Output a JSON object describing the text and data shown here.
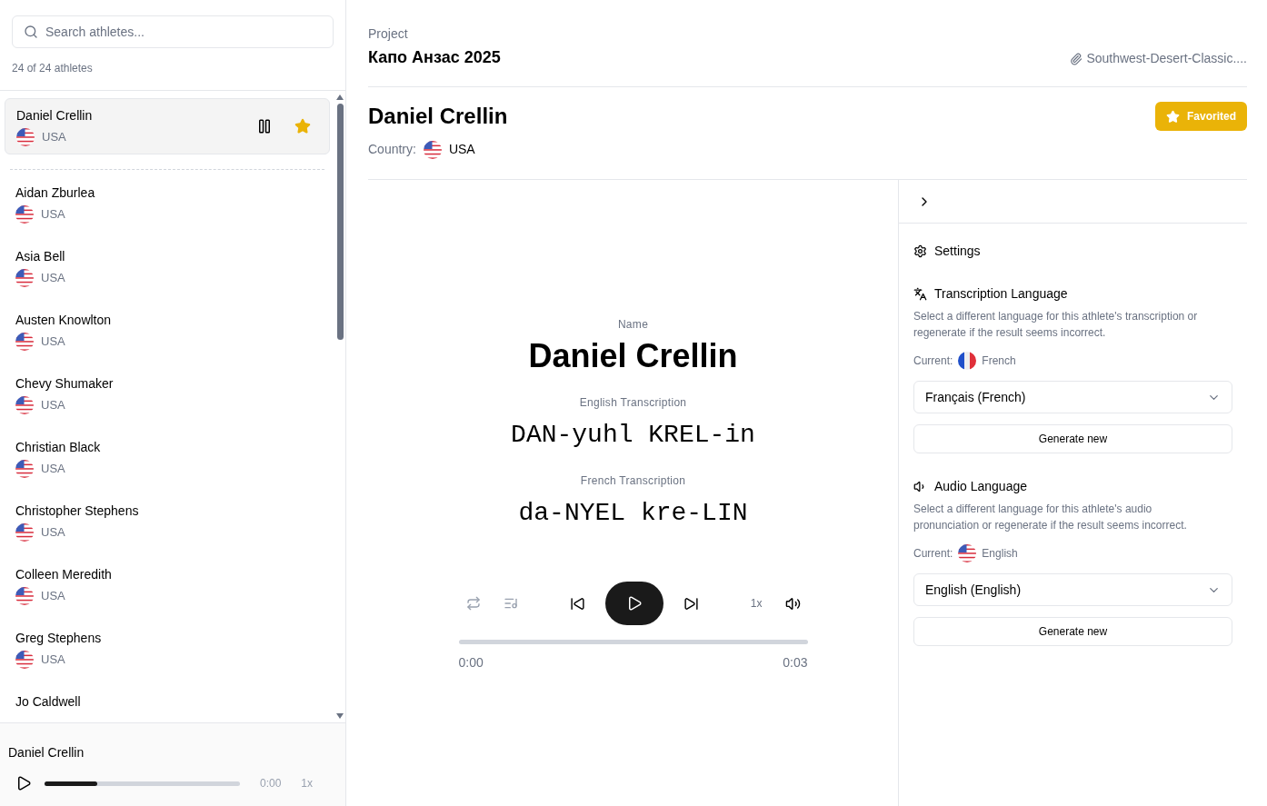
{
  "sidebar": {
    "search": {
      "placeholder": "Search athletes..."
    },
    "count": "24 of 24 athletes",
    "athletes": [
      {
        "name": "Daniel Crellin",
        "country": "USA",
        "selected": true,
        "playing": true,
        "favorited": true
      },
      {
        "name": "Aidan Zburlea",
        "country": "USA",
        "selected": false,
        "playing": false,
        "favorited": false
      },
      {
        "name": "Asia Bell",
        "country": "USA",
        "selected": false,
        "playing": false,
        "favorited": false
      },
      {
        "name": "Austen Knowlton",
        "country": "USA",
        "selected": false,
        "playing": false,
        "favorited": false
      },
      {
        "name": "Chevy Shumaker",
        "country": "USA",
        "selected": false,
        "playing": false,
        "favorited": false
      },
      {
        "name": "Christian Black",
        "country": "USA",
        "selected": false,
        "playing": false,
        "favorited": false
      },
      {
        "name": "Christopher Stephens",
        "country": "USA",
        "selected": false,
        "playing": false,
        "favorited": false
      },
      {
        "name": "Colleen Meredith",
        "country": "USA",
        "selected": false,
        "playing": false,
        "favorited": false
      },
      {
        "name": "Greg Stephens",
        "country": "USA",
        "selected": false,
        "playing": false,
        "favorited": false
      },
      {
        "name": "Jo Caldwell",
        "selected": false,
        "playing": false,
        "favorited": false
      }
    ]
  },
  "mini_player": {
    "title": "Daniel Crellin",
    "playing": false,
    "level": 0.27,
    "time": "0:00",
    "speed": "1x"
  },
  "project": {
    "label": "Project",
    "name": "Капо Анзас 2025",
    "file": "Southwest-Desert-Classic...."
  },
  "athlete": {
    "name": "Daniel Crellin",
    "country_label": "Country:",
    "country": "USA",
    "favorited": true,
    "favorite_label": "Favorited"
  },
  "preview": {
    "name_label": "Name",
    "name": "Daniel Crellin",
    "transcriptions": [
      {
        "label": "English Transcription",
        "text": "DAN-yuhl KREL-in"
      },
      {
        "label": "French Transcription",
        "text": "da-NYEL kre-LIN"
      }
    ],
    "player": {
      "playing": false,
      "speed": "1x",
      "level": 0,
      "start": "0:00",
      "end": "0:03"
    }
  },
  "settings": {
    "title": "Settings",
    "sections": [
      {
        "kind": "transcription",
        "title": "Transcription Language",
        "description": "Select a different language for this athlete's transcription or regenerate if the result seems incorrect.",
        "current_label": "Current:",
        "current": {
          "kind": "fr",
          "text": "French"
        },
        "select": "Français (French)",
        "button": "Generate new"
      },
      {
        "kind": "audio",
        "title": "Audio Language",
        "description": "Select a different language for this athlete's audio pronunciation or regenerate if the result seems incorrect.",
        "current_label": "Current:",
        "current": {
          "kind": "us",
          "text": "English"
        },
        "select": "English (English)",
        "button": "Generate new"
      }
    ]
  }
}
